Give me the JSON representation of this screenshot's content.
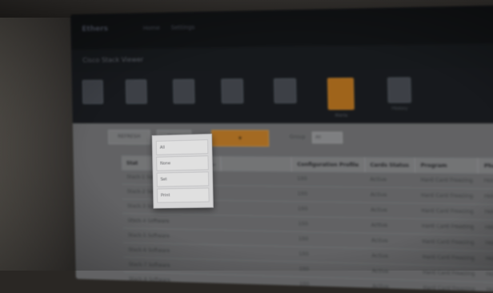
{
  "app": {
    "logo": "Ethers",
    "nav": [
      "Home",
      "Settings"
    ],
    "page_title": "Cisco Stack Viewer"
  },
  "toolbar": {
    "buttons": [
      "REFRESH",
      "Show",
      ""
    ],
    "group_label": "Group",
    "group_value": "All"
  },
  "icons": [
    {
      "name": "ports-icon",
      "label": ""
    },
    {
      "name": "config-icon",
      "label": ""
    },
    {
      "name": "monitor-icon",
      "label": ""
    },
    {
      "name": "report-icon",
      "label": ""
    },
    {
      "name": "settings-icon",
      "label": ""
    },
    {
      "name": "alert-icon",
      "label": "Alerts"
    },
    {
      "name": "history-icon",
      "label": "History"
    }
  ],
  "dropdown": {
    "items": [
      "All",
      "None",
      "Set",
      "Print"
    ]
  },
  "table": {
    "columns": [
      "Stat",
      "Cameras Pr...",
      "",
      "Configuration Profile",
      "Cards Status",
      "Program",
      "Phase"
    ],
    "rows": [
      [
        "Stack-1 Software",
        "",
        "",
        "100",
        "Active",
        "Hard Card Freezing",
        "Holding"
      ],
      [
        "Stack-2 Software",
        "",
        "",
        "100",
        "Active",
        "Hard Card Freezing",
        "Holding"
      ],
      [
        "Stack-3 Software",
        "",
        "",
        "100",
        "Active",
        "Hard Card Freezing",
        "Holding"
      ],
      [
        "Stack-4 Software",
        "",
        "",
        "100",
        "Active",
        "Hard Card Freezing",
        "Holding"
      ],
      [
        "Stack-5 Software",
        "",
        "",
        "100",
        "Active",
        "Hard Card Freezing",
        "Holding"
      ],
      [
        "Stack-6 Software",
        "",
        "",
        "100",
        "Active",
        "Hard Card Freezing",
        "Holding"
      ],
      [
        "Stack-7 Software",
        "",
        "",
        "100",
        "Active",
        "Hard Card Freezing",
        "Holding"
      ],
      [
        "Stack-8 Software",
        "",
        "",
        "100",
        "Active",
        "Hard Card Freezing",
        "Holding"
      ]
    ]
  },
  "colors": {
    "accent": "#c8812a",
    "screen_bg": "#1f2226",
    "content_bg": "#77787a"
  }
}
